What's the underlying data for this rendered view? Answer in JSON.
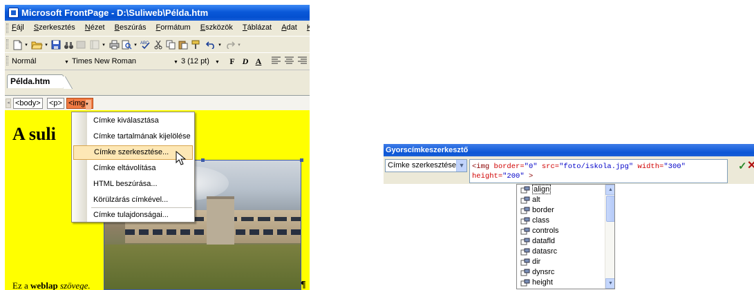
{
  "window": {
    "title": "Microsoft FrontPage - D:\\Suliweb\\Példa.htm"
  },
  "menu": [
    "Fájl",
    "Szerkesztés",
    "Nézet",
    "Beszúrás",
    "Formátum",
    "Eszközök",
    "Táblázat",
    "Adat",
    "Ke"
  ],
  "format_bar": {
    "style": "Normál",
    "font": "Times New Roman",
    "size": "3 (12 pt)",
    "bold": "F",
    "italic": "D",
    "underline": "A"
  },
  "tab": {
    "label": "Példa.htm"
  },
  "tag_selector": {
    "tags": [
      "<body>",
      "<p>",
      "<img"
    ]
  },
  "document": {
    "heading": "A suli",
    "footer_prefix": "Ez a ",
    "footer_bold": "weblap",
    "footer_italic": "szövege.",
    "pilcrow": "¶"
  },
  "context_menu": {
    "items": [
      "Címke kiválasztása",
      "Címke tartalmának kijelölése",
      "Címke szerkesztése...",
      "Címke eltávolítása",
      "HTML beszúrása...",
      "Körülzárás címkével...",
      "Címke tulajdonságai..."
    ],
    "highlighted": 2
  },
  "quick_tag_editor": {
    "title": "Gyorscímkeszerkesztő",
    "mode": "Címke szerkesztése",
    "code": {
      "tag": "<img",
      "attrs": [
        {
          "name": "border",
          "value": "\"0\""
        },
        {
          "name": "src",
          "value": "\"foto/iskola.jpg\""
        },
        {
          "name": "width",
          "value": "\"300\""
        },
        {
          "name": "height",
          "value": "\"200\""
        }
      ],
      "close": ">"
    },
    "ok": "✓",
    "cancel": "✕"
  },
  "attribute_list": [
    "align",
    "alt",
    "border",
    "class",
    "controls",
    "datafld",
    "datasrc",
    "dir",
    "dynsrc",
    "height"
  ],
  "colors": {
    "title_blue": "#0a58d8",
    "document_bg": "#ffff00",
    "tag_active": "#f07a43",
    "menu_highlight": "#fde7b5"
  }
}
